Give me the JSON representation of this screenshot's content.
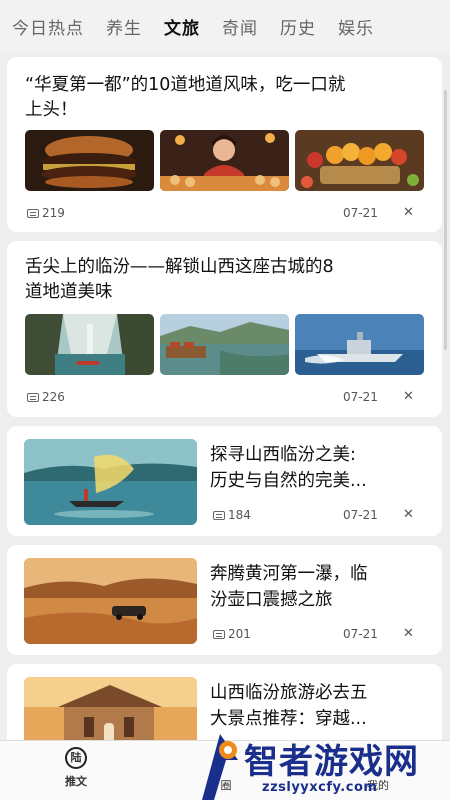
{
  "tabs": [
    {
      "label": "今日热点"
    },
    {
      "label": "养生"
    },
    {
      "label": "文旅",
      "active": true
    },
    {
      "label": "奇闻"
    },
    {
      "label": "历史"
    },
    {
      "label": "娱乐"
    }
  ],
  "articles": [
    {
      "title_line1": "“华夏第一都”的10道地道风味，吃一口就",
      "title_line2": "上头！",
      "comments": "219",
      "date": "07-21",
      "close": "✕"
    },
    {
      "title_line1": "舌尖上的临汾——解锁山西这座古城的8",
      "title_line2": "道地道美味",
      "comments": "226",
      "date": "07-21",
      "close": "✕"
    },
    {
      "title_line1": "探寻山西临汾之美:",
      "title_line2": "历史与自然的完美...",
      "comments": "184",
      "date": "07-21",
      "close": "✕"
    },
    {
      "title_line1": "奔腾黄河第一瀑，临",
      "title_line2": "汾壶口震撼之旅",
      "comments": "201",
      "date": "07-21",
      "close": "✕"
    },
    {
      "title_line1": "山西临汾旅游必去五",
      "title_line2": "大景点推荐：穿越..."
    }
  ],
  "bottom_nav": {
    "home_icon_text": "陆",
    "home_label": "推文",
    "circle_label": "圈",
    "me_label": "我的"
  },
  "watermark": {
    "text": "智者游戏网",
    "url": "zzslyyxcfy.com"
  }
}
